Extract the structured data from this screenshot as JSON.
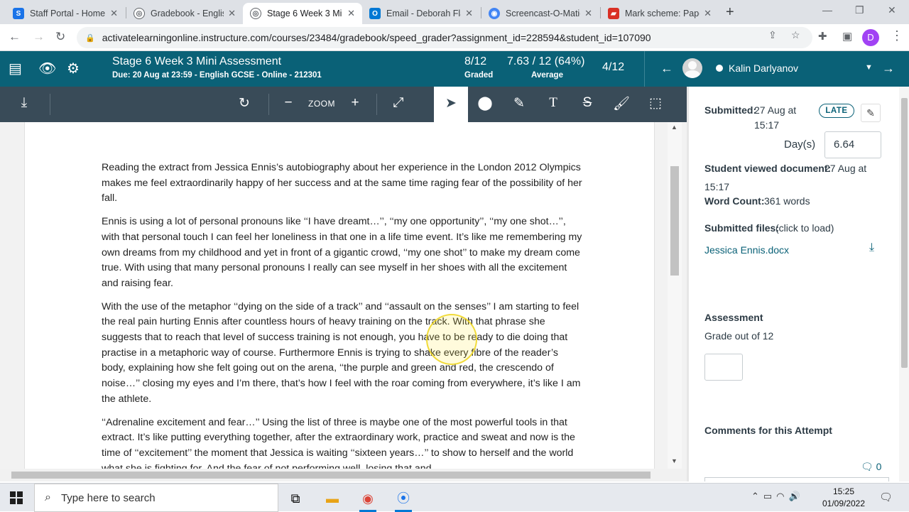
{
  "browser": {
    "tabs": [
      {
        "label": "Staff Portal - Home",
        "favicon_color": "#1a73e8",
        "favicon_glyph": "S"
      },
      {
        "label": "Gradebook - Englis",
        "favicon_color": "#5f6368",
        "favicon_glyph": "◎"
      },
      {
        "label": "Stage 6 Week 3 Mi",
        "favicon_color": "#5f6368",
        "favicon_glyph": "◎"
      },
      {
        "label": "Email - Deborah Fla",
        "favicon_color": "#0078d4",
        "favicon_glyph": "O"
      },
      {
        "label": "Screencast-O-Matic",
        "favicon_color": "#4285f4",
        "favicon_glyph": "◉"
      },
      {
        "label": "Mark scheme: Pape",
        "favicon_color": "#d93025",
        "favicon_glyph": "▰"
      }
    ],
    "url": "activatelearningonline.instructure.com/courses/23484/gradebook/speed_grader?assignment_id=228594&student_id=107090",
    "profile_initial": "D"
  },
  "header": {
    "assignment_title": "Stage 6 Week 3 Mini Assessment",
    "due": "Due: 20 Aug at 23:59 - English GCSE - Online - 212301",
    "graded_count": "8/12",
    "graded_label": "Graded",
    "average_value": "7.63 / 12 (64%)",
    "average_label": "Average",
    "student_position": "4/12",
    "student_name": "Kalin Darlyanov"
  },
  "toolbar": {
    "zoom_label": "ZOOM"
  },
  "document": {
    "paragraphs": [
      "Reading the extract from Jessica Ennis’s autobiography about her experience in the London 2012 Olympics makes me feel extraordinarily happy of her success and at the same time raging fear of the possibility of her fall.",
      "Ennis is using a lot of personal pronouns like ‘‘I have dreamt…’’, ‘‘my one opportunity’’, ‘‘my one shot…’’, with that personal touch I can feel her loneliness in that one in a life time event. It’s like me remembering my own dreams from my childhood and yet in front of a gigantic crowd, ‘‘my one shot’’ to make my dream come true. With using that many personal pronouns I really can see myself in her shoes with all the excitement and raising fear.",
      "With the use of the metaphor ‘‘dying on the side of a track’’ and ‘‘assault on the senses’’ I am starting to feel the real pain hurting Ennis after countless hours of heavy training on the track. With that phrase she suggests that to reach that level of success training is not enough, you have to be ready to die doing that practise in a metaphoric way of course. Furthermore Ennis is trying to shake every fibre of the reader’s body, explaining how she felt going out on the arena, ‘‘the purple and green and red, the crescendo of noise…’’ closing my eyes and I’m there, that’s how I feel with the roar coming from everywhere, it’s like I am the athlete.",
      "‘‘Adrenaline excitement and fear…’’ Using the list of three is maybe one of the most powerful tools in that extract. It’s like putting everything together, after the extraordinary work, practice and sweat and now is the time of ‘‘excitement’’ the moment that Jessica is waiting ‘‘sixteen years…’’ to show to herself and the world what she is fighting for. And the fear of not performing well, losing that and"
    ]
  },
  "panel": {
    "submitted_label": "Submitted:",
    "submitted_date": "27 Aug at",
    "submitted_time": "15:17",
    "late_badge": "LATE",
    "days_label": "Day(s)",
    "days_value": "6.64",
    "viewed_label": "Student viewed document:",
    "viewed_date": "27 Aug at",
    "viewed_time": "15:17",
    "wordcount_label": "Word Count:",
    "wordcount_value": "361 words",
    "files_label": "Submitted files:",
    "files_hint": "(click to load)",
    "file_name": "Jessica Ennis.docx",
    "assessment_heading": "Assessment",
    "grade_label": "Grade out of 12",
    "comments_heading": "Comments for this Attempt",
    "comments_count": "0"
  },
  "taskbar": {
    "search_placeholder": "Type here to search",
    "time": "15:25",
    "date": "01/09/2022"
  },
  "colors": {
    "canvas_teal": "#0a6177",
    "toolbar_slate": "#394b58",
    "link": "#0a6177"
  }
}
